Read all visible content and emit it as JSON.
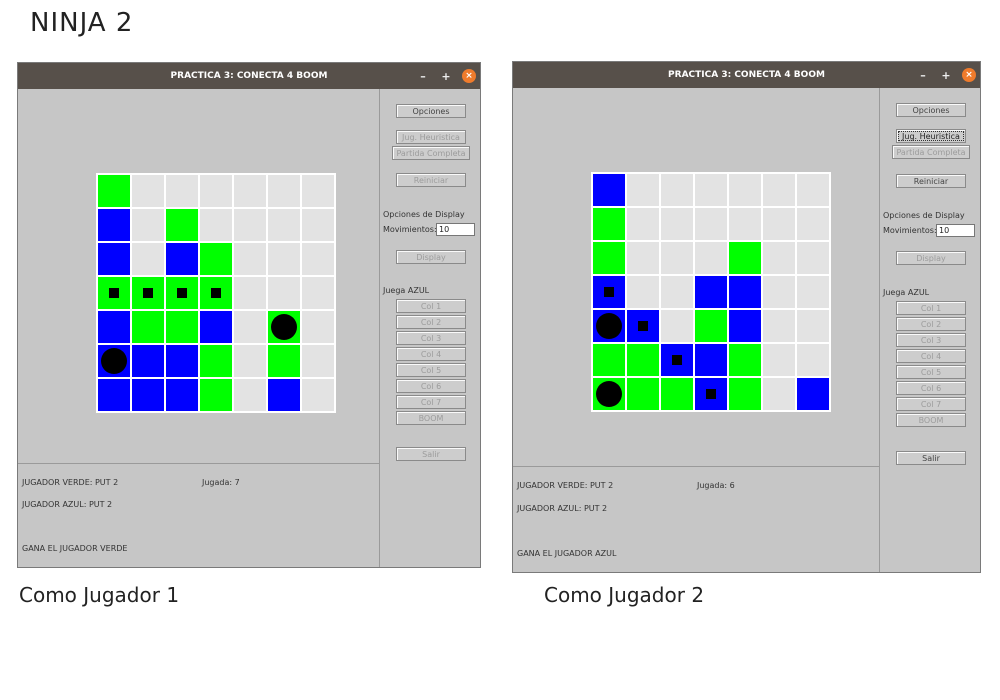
{
  "page_title": "NINJA 2",
  "captions": {
    "left": "Como Jugador 1",
    "right": "Como Jugador 2"
  },
  "colors": {
    "verde": "#00ff00",
    "azul": "#0000ff",
    "vacia": "#e3e3e3",
    "titlebar": "#57504a"
  },
  "windows": [
    {
      "title": "PRACTICA 3: CONECTA 4 BOOM",
      "controls": {
        "minimize": "–",
        "maximize": "+",
        "close": "×"
      },
      "buttons": {
        "opciones": "Opciones",
        "heuristica": "Jug. Heuristica",
        "completa": "Partida Completa",
        "reiniciar": "Reiniciar",
        "display": "Display",
        "boom": "BOOM",
        "salir": "Salir",
        "cols": [
          "Col 1",
          "Col 2",
          "Col 3",
          "Col 4",
          "Col 5",
          "Col 6",
          "Col 7"
        ]
      },
      "display_label": "Opciones de Display",
      "movimientos_label": "Movimientos:",
      "movimientos_value": "10",
      "juega": "Juega AZUL",
      "status": {
        "verde": "JUGADOR VERDE: PUT 2",
        "jugada": "Jugada: 7",
        "azul": "JUGADOR AZUL: PUT 2",
        "result": "GANA EL JUGADOR VERDE"
      },
      "board": [
        [
          "g",
          "e",
          "e",
          "e",
          "e",
          "e",
          "e"
        ],
        [
          "b",
          "e",
          "g",
          "e",
          "e",
          "e",
          "e"
        ],
        [
          "b",
          "e",
          "b",
          "g",
          "e",
          "e",
          "e"
        ],
        [
          "g*",
          "g*",
          "g*",
          "g*",
          "e",
          "e",
          "e"
        ],
        [
          "b",
          "g",
          "g",
          "b",
          "e",
          "g@",
          "e"
        ],
        [
          "b@",
          "b",
          "b",
          "g",
          "e",
          "g",
          "e"
        ],
        [
          "b",
          "b",
          "b",
          "g",
          "e",
          "b",
          "e"
        ]
      ]
    },
    {
      "title": "PRACTICA 3: CONECTA 4 BOOM",
      "controls": {
        "minimize": "–",
        "maximize": "+",
        "close": "×"
      },
      "buttons": {
        "opciones": "Opciones",
        "heuristica": "Jug. Heuristica",
        "completa": "Partida Completa",
        "reiniciar": "Reiniciar",
        "display": "Display",
        "boom": "BOOM",
        "salir": "Salir",
        "cols": [
          "Col 1",
          "Col 2",
          "Col 3",
          "Col 4",
          "Col 5",
          "Col 6",
          "Col 7"
        ]
      },
      "display_label": "Opciones de Display",
      "movimientos_label": "Movimientos:",
      "movimientos_value": "10",
      "juega": "Juega AZUL",
      "status": {
        "verde": "JUGADOR VERDE: PUT 2",
        "jugada": "Jugada: 6",
        "azul": "JUGADOR AZUL: PUT 2",
        "result": "GANA EL JUGADOR AZUL"
      },
      "board": [
        [
          "b",
          "e",
          "e",
          "e",
          "e",
          "e",
          "e"
        ],
        [
          "g",
          "e",
          "e",
          "e",
          "e",
          "e",
          "e"
        ],
        [
          "g",
          "e",
          "e",
          "e",
          "g",
          "e",
          "e"
        ],
        [
          "b*",
          "e",
          "e",
          "b",
          "b",
          "e",
          "e"
        ],
        [
          "b@",
          "b*",
          "e",
          "g",
          "b",
          "e",
          "e"
        ],
        [
          "g",
          "g",
          "b*",
          "b",
          "g",
          "e",
          "e"
        ],
        [
          "g@",
          "g",
          "g",
          "b*",
          "g",
          "e",
          "b"
        ]
      ]
    }
  ]
}
